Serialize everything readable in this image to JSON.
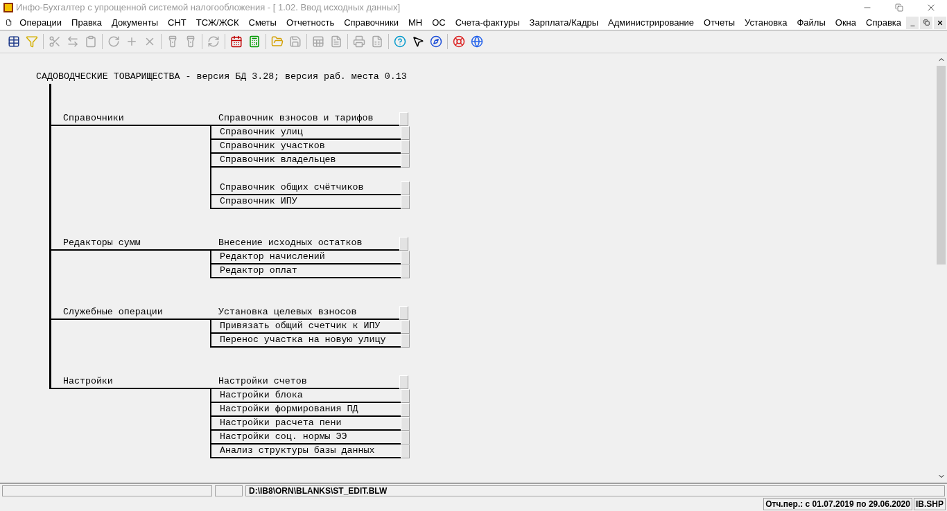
{
  "window": {
    "title": "Инфо-Бухгалтер с упрощенной системой налогообложения - [ 1.02. Ввод исходных данных]"
  },
  "menu": [
    "Операции",
    "Правка",
    "Документы",
    "СНТ",
    "ТСЖ/ЖСК",
    "Сметы",
    "Отчетность",
    "Справочники",
    "МН",
    "ОС",
    "Счета-фактуры",
    "Зарплата/Кадры",
    "Администрирование",
    "Отчеты",
    "Установка",
    "Файлы",
    "Окна",
    "Справка"
  ],
  "toolbar": [
    [
      {
        "kind": "grid",
        "disabled": false
      },
      {
        "kind": "filter",
        "disabled": false
      }
    ],
    [
      {
        "kind": "cut",
        "disabled": true
      },
      {
        "kind": "move",
        "disabled": true
      },
      {
        "kind": "paste",
        "disabled": true
      }
    ],
    [
      {
        "kind": "rotate",
        "disabled": true
      },
      {
        "kind": "add",
        "disabled": true
      },
      {
        "kind": "delete",
        "disabled": true
      }
    ],
    [
      {
        "kind": "find",
        "disabled": true
      },
      {
        "kind": "find-replace",
        "disabled": true
      }
    ],
    [
      {
        "kind": "refresh",
        "disabled": true
      }
    ],
    [
      {
        "kind": "calendar",
        "disabled": false
      },
      {
        "kind": "calculator",
        "disabled": false
      }
    ],
    [
      {
        "kind": "open",
        "disabled": false
      },
      {
        "kind": "save",
        "disabled": true
      }
    ],
    [
      {
        "kind": "excel",
        "disabled": true
      },
      {
        "kind": "word",
        "disabled": true
      }
    ],
    [
      {
        "kind": "print",
        "disabled": true
      },
      {
        "kind": "preview",
        "disabled": true
      }
    ],
    [
      {
        "kind": "help",
        "disabled": false
      },
      {
        "kind": "context-help",
        "disabled": false
      },
      {
        "kind": "compass",
        "disabled": false
      }
    ],
    [
      {
        "kind": "support",
        "disabled": false
      },
      {
        "kind": "web",
        "disabled": false
      }
    ]
  ],
  "header": "САДОВОДЧЕСКИЕ ТОВАРИЩЕСТВА - версия БД 3.28; версия раб. места 0.13",
  "groups": [
    {
      "label": "Справочники",
      "sections": [
        {
          "items": [
            "Справочник взносов и тарифов",
            "Справочник улиц",
            "Справочник участков",
            "Справочник владельцев"
          ]
        },
        {
          "items": [
            "Справочник общих счётчиков",
            "Справочник ИПУ"
          ]
        }
      ]
    },
    {
      "label": "Редакторы сумм",
      "sections": [
        {
          "items": [
            "Внесение исходных остатков",
            "Редактор начислений",
            "Редактор оплат"
          ]
        }
      ]
    },
    {
      "label": "Служебные операции",
      "sections": [
        {
          "items": [
            "Установка целевых взносов",
            "Привязать общий счетчик к ИПУ",
            "Перенос участка на новую улицу"
          ]
        }
      ]
    },
    {
      "label": "Настройки",
      "sections": [
        {
          "items": [
            "Настройки счетов",
            "Настройки блока",
            "Настройки формирования ПД",
            "Настройки расчета пени",
            "Настройки соц. нормы ЭЭ",
            "Анализ структуры базы данных"
          ]
        }
      ]
    }
  ],
  "status_bar": {
    "path": "D:\\IB8\\ORN\\BLANKS\\ST_EDIT.BLW",
    "period": "Отч.пер.: с 01.07.2019 по 29.06.2020",
    "module": "IB.SHP"
  }
}
